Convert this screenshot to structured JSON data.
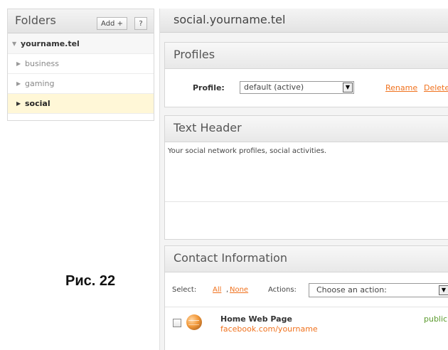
{
  "folders": {
    "title": "Folders",
    "add_label": "Add +",
    "help_label": "?",
    "root": "yourname.tel",
    "items": [
      {
        "label": "business"
      },
      {
        "label": "gaming"
      },
      {
        "label": "social",
        "active": true
      }
    ]
  },
  "main": {
    "title": "social.yourname.tel"
  },
  "profiles": {
    "title": "Profiles",
    "label": "Profile:",
    "selected": "default (active)",
    "rename": "Rename",
    "delete": "Delete"
  },
  "text_header": {
    "title": "Text Header",
    "body": "Your social network profiles, social activities."
  },
  "contact": {
    "title": "Contact Information",
    "select_label": "Select:",
    "all": "All",
    "none": "None",
    "actions_label": "Actions:",
    "actions_selected": "Choose an action:",
    "item_title": "Home Web Page",
    "item_url": "facebook.com/yourname",
    "item_status": "public"
  },
  "caption": "Рис. 22",
  "colors": {
    "accent_orange": "#f0721e",
    "active_row": "#fff7d7",
    "status_green": "#5a9a2c"
  }
}
